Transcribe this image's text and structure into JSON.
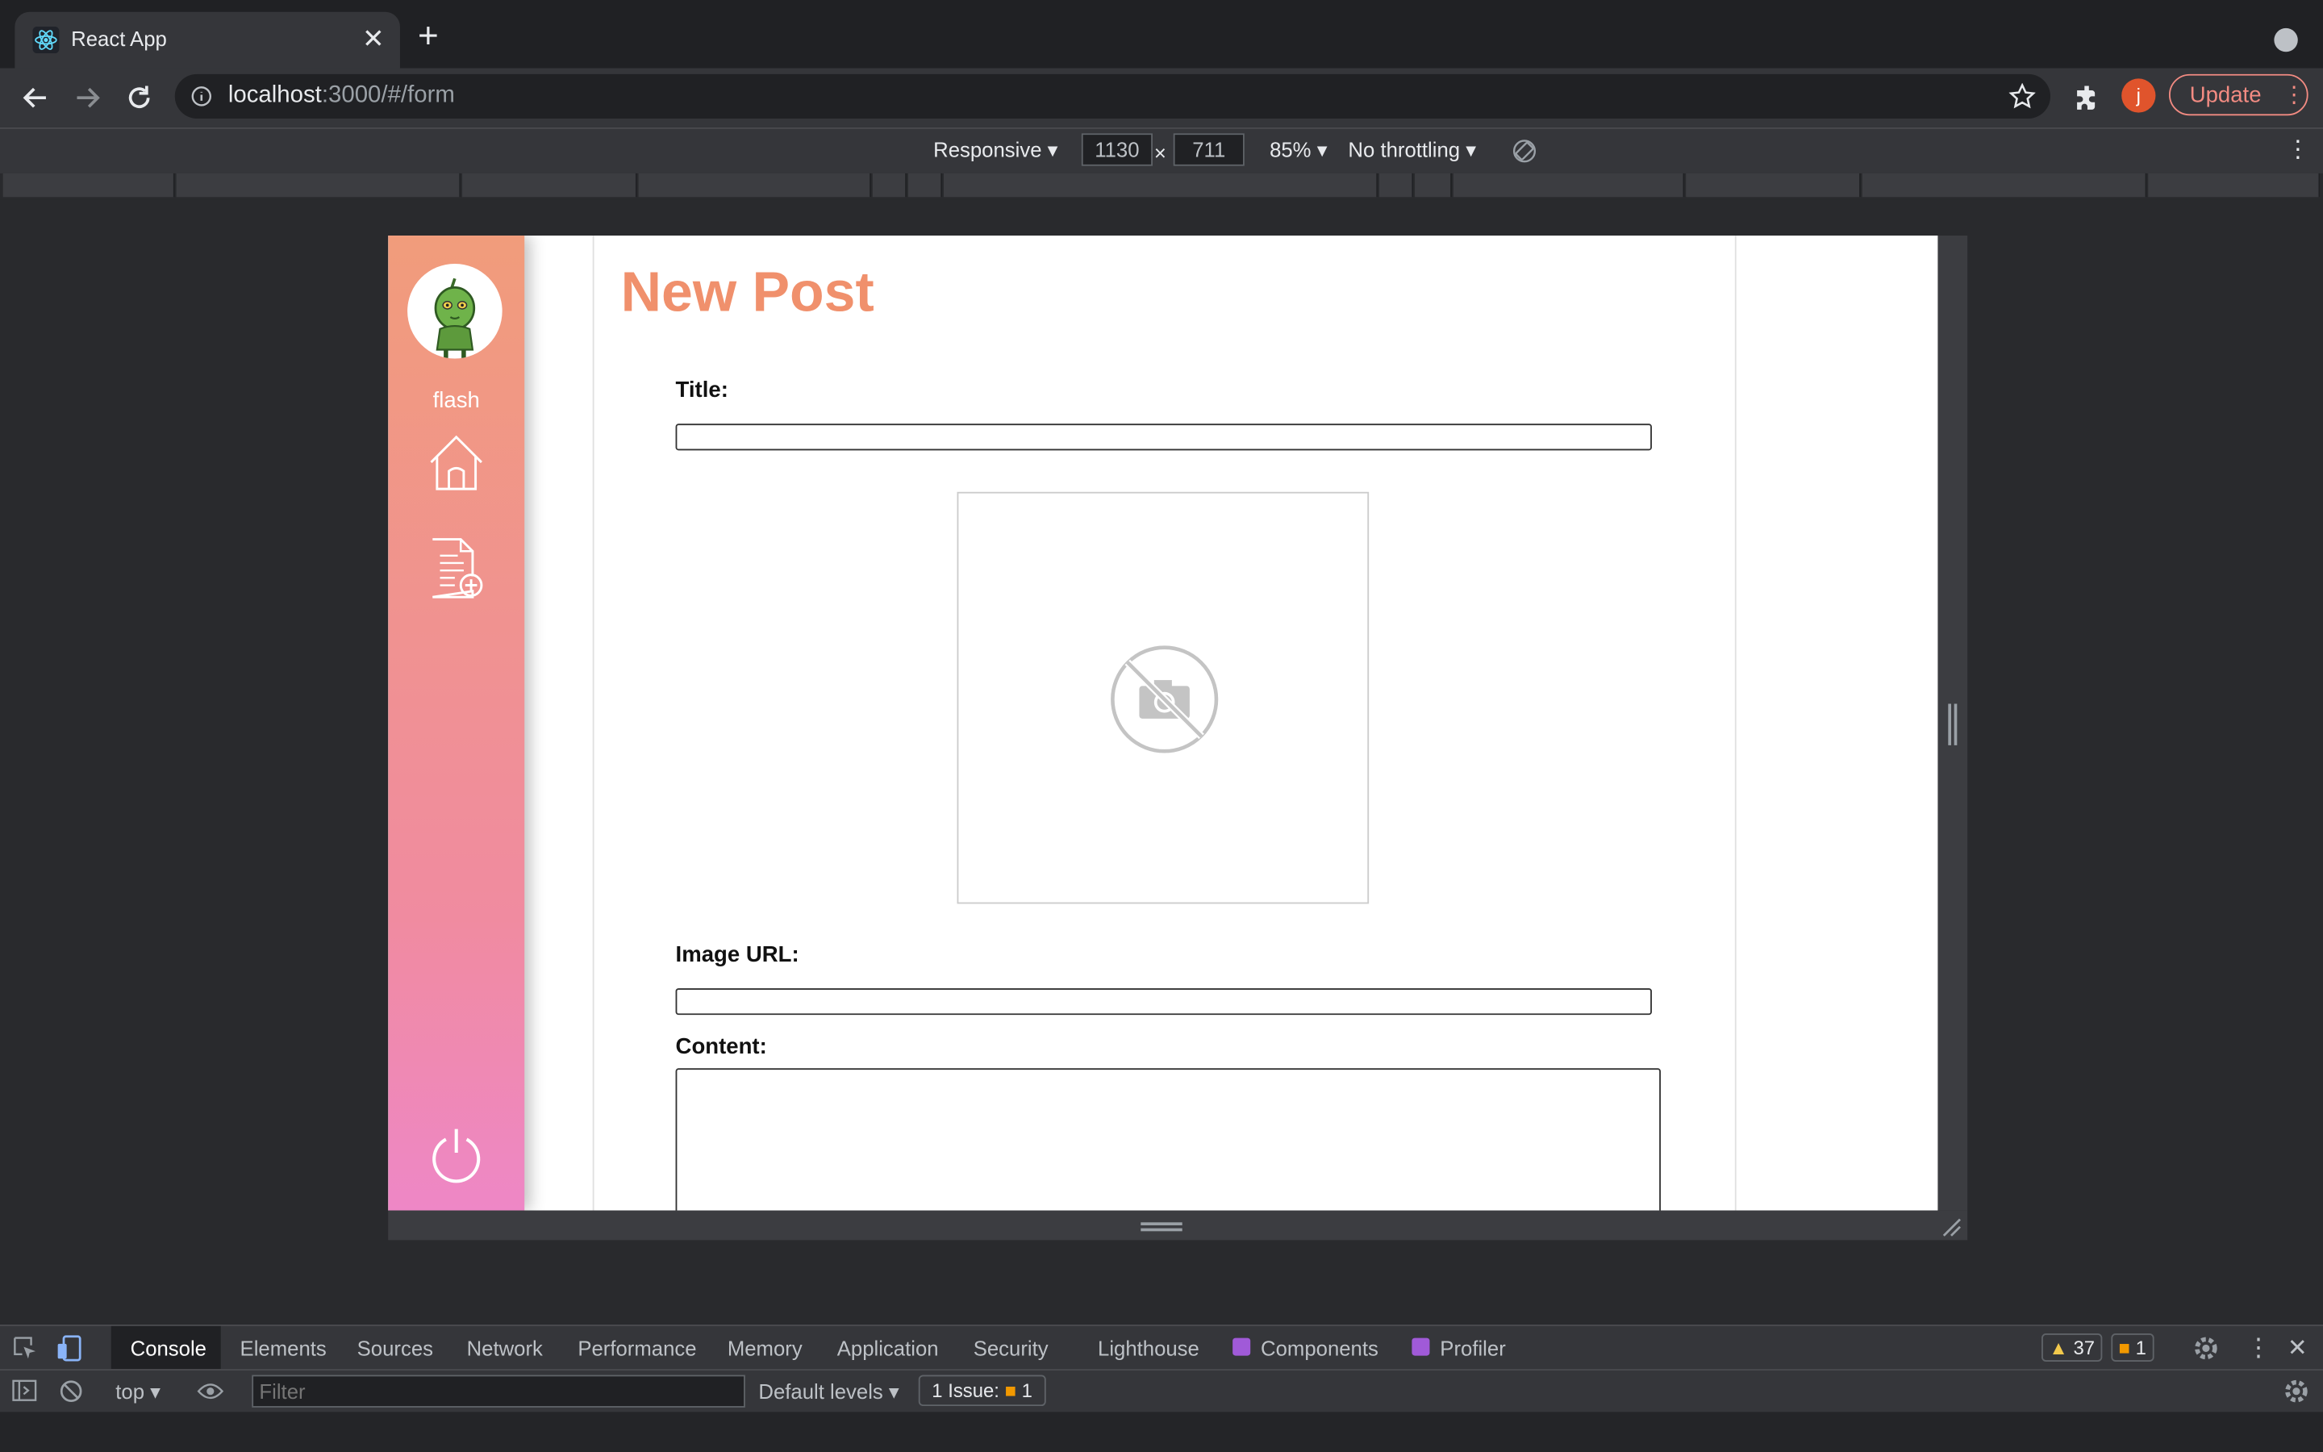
{
  "browser": {
    "tab_title": "React App",
    "tab_close": "✕",
    "new_tab": "+",
    "url_host": "localhost",
    "url_path": ":3000/#/form",
    "profile_initial": "j",
    "update_label": "Update"
  },
  "device_toolbar": {
    "device": "Responsive ▾",
    "width": "1130",
    "times": "×",
    "height": "711",
    "zoom": "85% ▾",
    "throttling": "No throttling ▾"
  },
  "app": {
    "username": "flash",
    "page_title": "New Post",
    "title_label": "Title:",
    "image_url_label": "Image URL:",
    "content_label": "Content:",
    "title_value": "",
    "image_url_value": "",
    "content_value": "",
    "accent_color": "#f0906c"
  },
  "devtools": {
    "tabs": [
      "Console",
      "Elements",
      "Sources",
      "Network",
      "Performance",
      "Memory",
      "Application",
      "Security",
      "Lighthouse",
      "Components",
      "Profiler"
    ],
    "warnings_count": "37",
    "issues_count": "1",
    "context": "top ▾",
    "filter_placeholder": "Filter",
    "levels": "Default levels ▾",
    "issue_label": "1 Issue:",
    "issue_count": "1"
  }
}
